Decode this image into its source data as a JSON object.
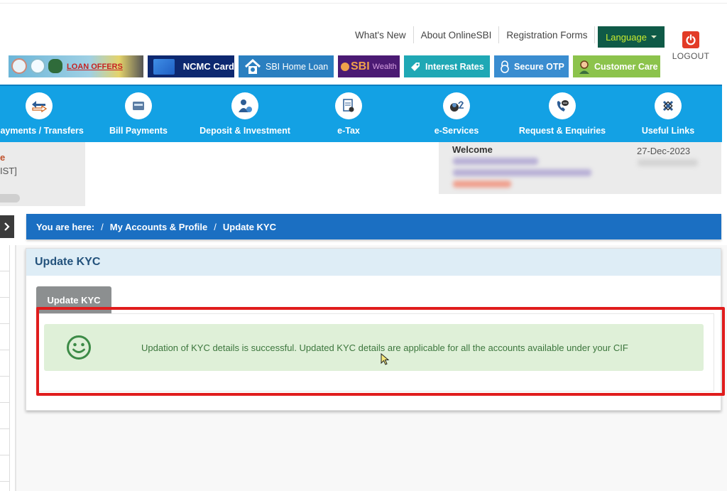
{
  "top_links": [
    "What's New",
    "About OnlineSBI",
    "Registration Forms"
  ],
  "language_button": "Language",
  "logout_label": "LOGOUT",
  "banners": {
    "loan_offers": "LOAN OFFERS",
    "ncmc": "NCMC Card",
    "home_loan": "SBI Home Loan",
    "wealth_brand": "SBI",
    "wealth_sub": "Wealth",
    "interest_rates": "Interest Rates",
    "secure_otp": "Secure OTP",
    "customer_care": "Customer Care"
  },
  "main_nav": [
    {
      "label": "Payments / Transfers",
      "icon": "transfer-icon"
    },
    {
      "label": "Bill Payments",
      "icon": "card-icon"
    },
    {
      "label": "Deposit & Investment",
      "icon": "investor-icon"
    },
    {
      "label": "e-Tax",
      "icon": "tax-document-icon"
    },
    {
      "label": "e-Services",
      "icon": "mouse-icon"
    },
    {
      "label": "Request & Enquiries",
      "icon": "phone-chat-icon"
    },
    {
      "label": "Useful Links",
      "icon": "links-icon"
    }
  ],
  "left_info": {
    "line1": "e",
    "line2": "IST]"
  },
  "welcome": {
    "label": "Welcome",
    "date": "27-Dec-2023"
  },
  "breadcrumb": {
    "prefix": "You are here:",
    "items": [
      "My Accounts & Profile",
      "Update KYC"
    ]
  },
  "panel": {
    "title": "Update KYC",
    "tab_label": "Update KYC",
    "success_message": "Updation of KYC details is successful. Updated KYC details are applicable for all the accounts available under your CIF"
  },
  "colors": {
    "nav_blue": "#13a1e4",
    "breadcrumb_blue": "#1b6fc2",
    "language_green": "#0f5a47",
    "success_bg": "#dff0d8",
    "success_text": "#3c763d",
    "highlight_red": "#e01c1c"
  }
}
